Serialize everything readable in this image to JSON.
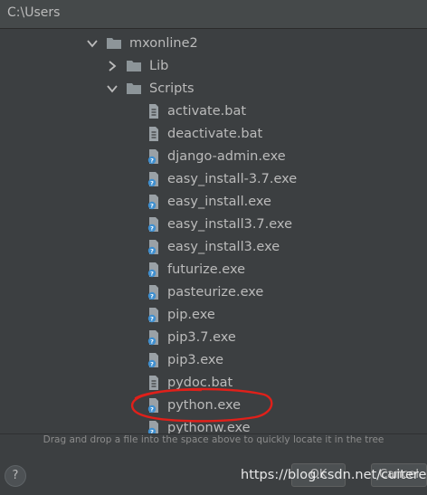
{
  "path_field": {
    "value": "C:\\Users"
  },
  "tree": [
    {
      "label": "mxonline2",
      "type": "folder",
      "expanded": true
    },
    {
      "label": "Lib",
      "type": "folder",
      "expanded": false
    },
    {
      "label": "Scripts",
      "type": "folder",
      "expanded": true
    },
    {
      "label": "activate.bat",
      "type": "bat"
    },
    {
      "label": "deactivate.bat",
      "type": "bat"
    },
    {
      "label": "django-admin.exe",
      "type": "exe"
    },
    {
      "label": "easy_install-3.7.exe",
      "type": "exe"
    },
    {
      "label": "easy_install.exe",
      "type": "exe"
    },
    {
      "label": "easy_install3.7.exe",
      "type": "exe"
    },
    {
      "label": "easy_install3.exe",
      "type": "exe"
    },
    {
      "label": "futurize.exe",
      "type": "exe"
    },
    {
      "label": "pasteurize.exe",
      "type": "exe"
    },
    {
      "label": "pip.exe",
      "type": "exe"
    },
    {
      "label": "pip3.7.exe",
      "type": "exe"
    },
    {
      "label": "pip3.exe",
      "type": "exe"
    },
    {
      "label": "pydoc.bat",
      "type": "bat"
    },
    {
      "label": "python.exe",
      "type": "exe",
      "annotated": true
    },
    {
      "label": "pythonw.exe",
      "type": "exe"
    }
  ],
  "hint": "Drag and drop a file into the space above to quickly locate it in the tree",
  "buttons": {
    "help": "?",
    "ok": "OK",
    "cancel": "Cancel"
  },
  "watermark": "https://blog.csdn.net/cuiterel",
  "colors": {
    "annotation": "#e0201a",
    "exe_badge": "#3f8fcf",
    "folder": "#8d9599"
  }
}
